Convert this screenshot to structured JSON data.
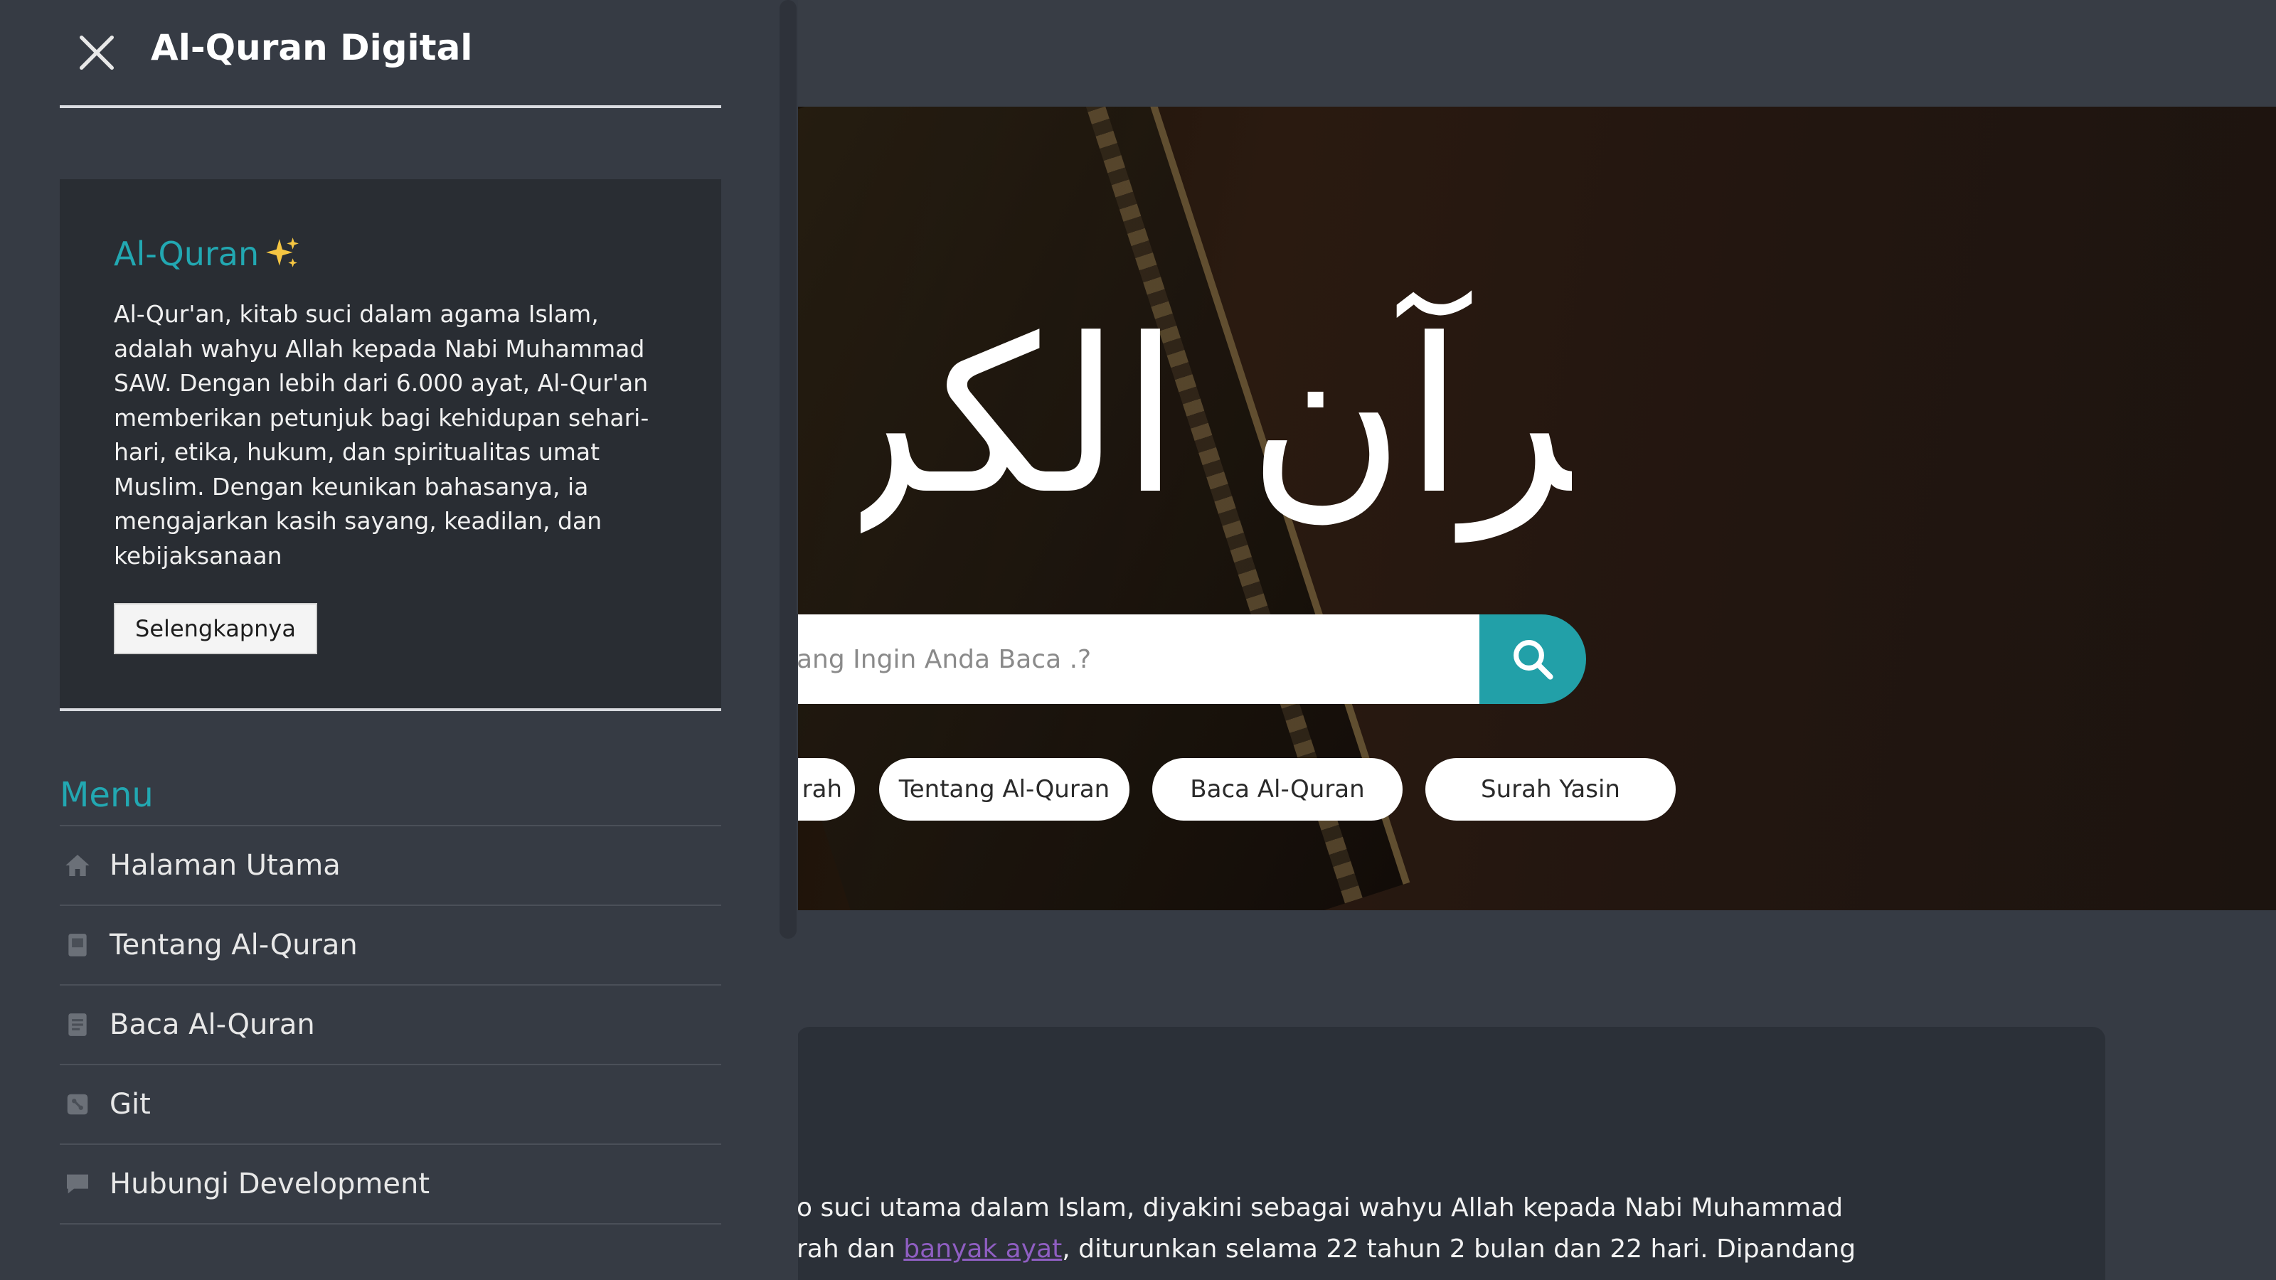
{
  "sidebar": {
    "title": "Al-Quran Digital",
    "close_icon": "close-icon",
    "info": {
      "title": "Al-Quran",
      "sparkle_icon": "sparkles-icon",
      "desc_lines": [
        "Al-Qur'an, kitab suci dalam agama Islam,",
        "adalah wahyu Allah kepada Nabi Muhammad",
        "SAW. Dengan lebih dari 6.000 ayat, Al-Qur'an",
        "memberikan petunjuk bagi kehidupan sehari-",
        "hari, etika, hukum, dan spiritualitas umat",
        "Muslim. Dengan keunikan bahasanya, ia",
        "mengajarkan kasih sayang, keadilan, dan",
        "kebijaksanaan"
      ],
      "button_label": "Selengkapnya"
    },
    "menu_title": "Menu",
    "menu_items": [
      {
        "label": "Halaman Utama",
        "icon": "home-icon"
      },
      {
        "label": "Tentang Al-Quran",
        "icon": "book-icon"
      },
      {
        "label": "Baca Al-Quran",
        "icon": "document-icon"
      },
      {
        "label": "Git",
        "icon": "git-icon"
      },
      {
        "label": "Hubungi Development",
        "icon": "chat-icon"
      }
    ]
  },
  "hero": {
    "calligraphy": "القرآن الكريم",
    "search": {
      "placeholder": "ang Ingin Anda Baca .?",
      "button_icon": "search-icon"
    },
    "quick_links": [
      "rah",
      "Tentang Al-Quran",
      "Baca Al-Quran",
      "Surah Yasin"
    ]
  },
  "content": {
    "line1": "o suci utama dalam Islam, diyakini sebagai wahyu Allah kepada Nabi Muhammad",
    "line2_pre": "rah dan ",
    "line2_link": "banyak ayat",
    "line2_post": ", diturunkan selama 22 tahun 2 bulan dan 22 hari. Dipandang"
  },
  "colors": {
    "accent": "#22a0a8",
    "background": "#363b44",
    "card": "#292d33"
  }
}
